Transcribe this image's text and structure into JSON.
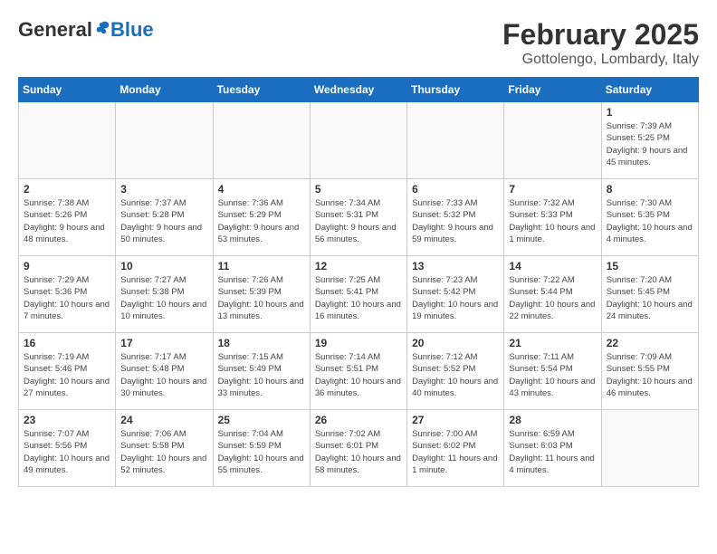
{
  "logo": {
    "general": "General",
    "blue": "Blue"
  },
  "title": "February 2025",
  "subtitle": "Gottolengo, Lombardy, Italy",
  "days_of_week": [
    "Sunday",
    "Monday",
    "Tuesday",
    "Wednesday",
    "Thursday",
    "Friday",
    "Saturday"
  ],
  "weeks": [
    [
      {
        "day": "",
        "info": ""
      },
      {
        "day": "",
        "info": ""
      },
      {
        "day": "",
        "info": ""
      },
      {
        "day": "",
        "info": ""
      },
      {
        "day": "",
        "info": ""
      },
      {
        "day": "",
        "info": ""
      },
      {
        "day": "1",
        "info": "Sunrise: 7:39 AM\nSunset: 5:25 PM\nDaylight: 9 hours and 45 minutes."
      }
    ],
    [
      {
        "day": "2",
        "info": "Sunrise: 7:38 AM\nSunset: 5:26 PM\nDaylight: 9 hours and 48 minutes."
      },
      {
        "day": "3",
        "info": "Sunrise: 7:37 AM\nSunset: 5:28 PM\nDaylight: 9 hours and 50 minutes."
      },
      {
        "day": "4",
        "info": "Sunrise: 7:36 AM\nSunset: 5:29 PM\nDaylight: 9 hours and 53 minutes."
      },
      {
        "day": "5",
        "info": "Sunrise: 7:34 AM\nSunset: 5:31 PM\nDaylight: 9 hours and 56 minutes."
      },
      {
        "day": "6",
        "info": "Sunrise: 7:33 AM\nSunset: 5:32 PM\nDaylight: 9 hours and 59 minutes."
      },
      {
        "day": "7",
        "info": "Sunrise: 7:32 AM\nSunset: 5:33 PM\nDaylight: 10 hours and 1 minute."
      },
      {
        "day": "8",
        "info": "Sunrise: 7:30 AM\nSunset: 5:35 PM\nDaylight: 10 hours and 4 minutes."
      }
    ],
    [
      {
        "day": "9",
        "info": "Sunrise: 7:29 AM\nSunset: 5:36 PM\nDaylight: 10 hours and 7 minutes."
      },
      {
        "day": "10",
        "info": "Sunrise: 7:27 AM\nSunset: 5:38 PM\nDaylight: 10 hours and 10 minutes."
      },
      {
        "day": "11",
        "info": "Sunrise: 7:26 AM\nSunset: 5:39 PM\nDaylight: 10 hours and 13 minutes."
      },
      {
        "day": "12",
        "info": "Sunrise: 7:25 AM\nSunset: 5:41 PM\nDaylight: 10 hours and 16 minutes."
      },
      {
        "day": "13",
        "info": "Sunrise: 7:23 AM\nSunset: 5:42 PM\nDaylight: 10 hours and 19 minutes."
      },
      {
        "day": "14",
        "info": "Sunrise: 7:22 AM\nSunset: 5:44 PM\nDaylight: 10 hours and 22 minutes."
      },
      {
        "day": "15",
        "info": "Sunrise: 7:20 AM\nSunset: 5:45 PM\nDaylight: 10 hours and 24 minutes."
      }
    ],
    [
      {
        "day": "16",
        "info": "Sunrise: 7:19 AM\nSunset: 5:46 PM\nDaylight: 10 hours and 27 minutes."
      },
      {
        "day": "17",
        "info": "Sunrise: 7:17 AM\nSunset: 5:48 PM\nDaylight: 10 hours and 30 minutes."
      },
      {
        "day": "18",
        "info": "Sunrise: 7:15 AM\nSunset: 5:49 PM\nDaylight: 10 hours and 33 minutes."
      },
      {
        "day": "19",
        "info": "Sunrise: 7:14 AM\nSunset: 5:51 PM\nDaylight: 10 hours and 36 minutes."
      },
      {
        "day": "20",
        "info": "Sunrise: 7:12 AM\nSunset: 5:52 PM\nDaylight: 10 hours and 40 minutes."
      },
      {
        "day": "21",
        "info": "Sunrise: 7:11 AM\nSunset: 5:54 PM\nDaylight: 10 hours and 43 minutes."
      },
      {
        "day": "22",
        "info": "Sunrise: 7:09 AM\nSunset: 5:55 PM\nDaylight: 10 hours and 46 minutes."
      }
    ],
    [
      {
        "day": "23",
        "info": "Sunrise: 7:07 AM\nSunset: 5:56 PM\nDaylight: 10 hours and 49 minutes."
      },
      {
        "day": "24",
        "info": "Sunrise: 7:06 AM\nSunset: 5:58 PM\nDaylight: 10 hours and 52 minutes."
      },
      {
        "day": "25",
        "info": "Sunrise: 7:04 AM\nSunset: 5:59 PM\nDaylight: 10 hours and 55 minutes."
      },
      {
        "day": "26",
        "info": "Sunrise: 7:02 AM\nSunset: 6:01 PM\nDaylight: 10 hours and 58 minutes."
      },
      {
        "day": "27",
        "info": "Sunrise: 7:00 AM\nSunset: 6:02 PM\nDaylight: 11 hours and 1 minute."
      },
      {
        "day": "28",
        "info": "Sunrise: 6:59 AM\nSunset: 6:03 PM\nDaylight: 11 hours and 4 minutes."
      },
      {
        "day": "",
        "info": ""
      }
    ]
  ]
}
